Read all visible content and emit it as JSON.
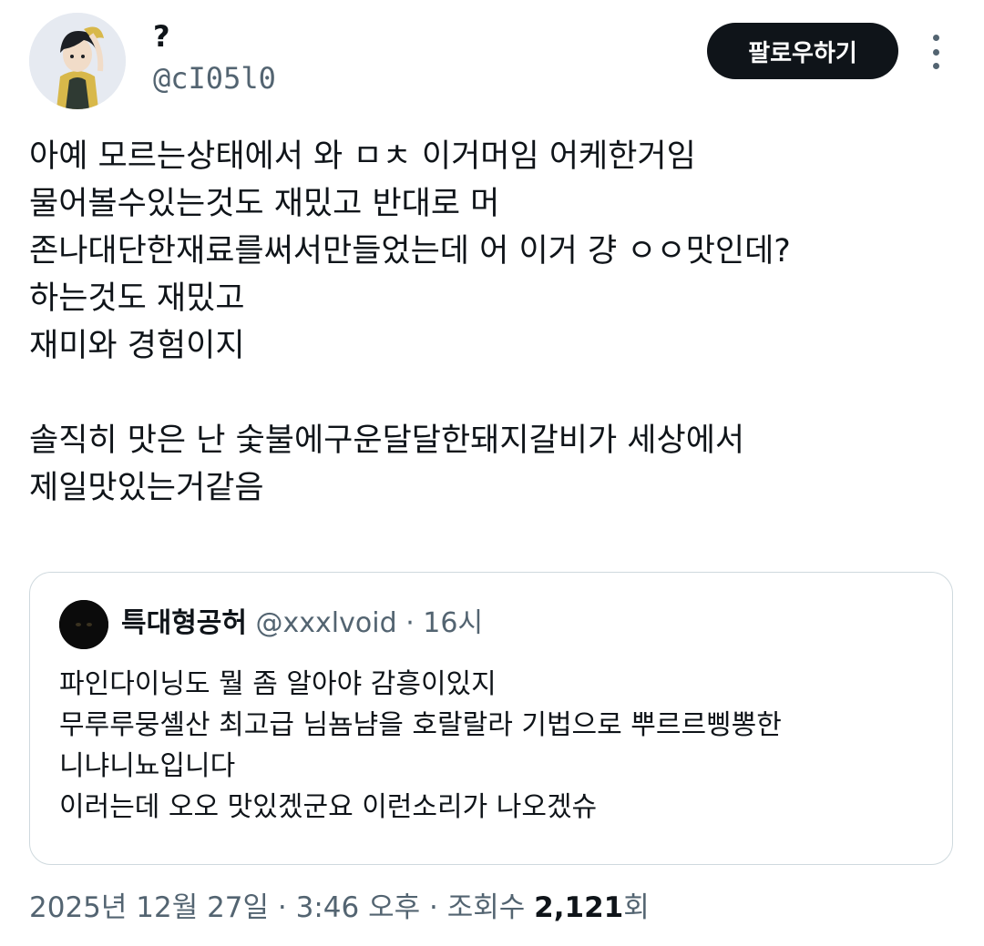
{
  "author": {
    "display_name": "?",
    "handle": "@cI05l0",
    "avatar_icon": "anime-character-avatar"
  },
  "header": {
    "follow_label": "팔로우하기",
    "more_icon": "more-vertical-icon"
  },
  "tweet": {
    "lines": [
      "아예 모르는상태에서 와 ㅁㅊ 이거머임 어케한거임",
      "물어볼수있는것도 재밌고 반대로 머",
      "존나대단한재료를써서만들었는데 어 이거 걍 ㅇㅇ맛인데?",
      "하는것도 재밌고",
      "재미와 경험이지",
      "",
      "솔직히 맛은 난 숯불에구운달달한돼지갈비가 세상에서",
      "제일맛있는거같음"
    ]
  },
  "quote": {
    "display_name": "특대형공허",
    "handle": "@xxxlvoid",
    "separator": "·",
    "time": "16시",
    "avatar_icon": "black-cat-avatar",
    "lines": [
      "파인다이닝도 뭘 좀 알아야 감흥이있지",
      "무루루뭉셸산 최고급 님뇸냠을 호랄랄라 기법으로 뿌르르삥뽕한",
      "니냐니뇨입니다",
      "이러는데 오오 맛있겠군요 이런소리가 나오겠슈"
    ]
  },
  "meta": {
    "date": "2025년 12월 27일",
    "separator": "·",
    "time": "3:46 오후",
    "views_label": "조회수",
    "views_count": "2,121",
    "views_suffix": "회"
  },
  "colors": {
    "text_primary": "#0f1419",
    "text_secondary": "#536471",
    "border": "#cfd9de",
    "button_bg": "#0f1419"
  }
}
